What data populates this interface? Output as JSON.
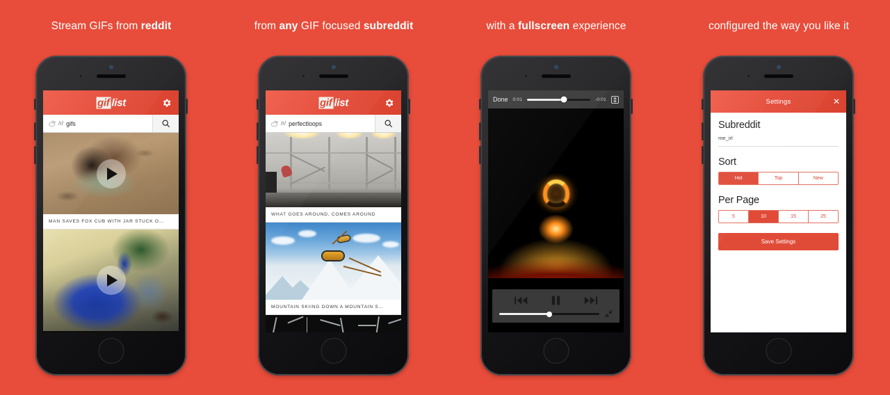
{
  "background_color": "#e84c3a",
  "accent_color": "#e04b38",
  "captions": [
    {
      "plain_before": "Stream GIFs from ",
      "bold": "reddit",
      "plain_after": ""
    },
    {
      "plain_before": "from ",
      "bold": "any",
      "plain_after": " GIF focused ",
      "bold2": "subreddit"
    },
    {
      "plain_before": "with a ",
      "bold": "fullscreen",
      "plain_after": " experience"
    },
    {
      "plain_before": "configured the way you like it",
      "bold": "",
      "plain_after": ""
    }
  ],
  "app": {
    "logo_gif": "gif",
    "logo_list": "list",
    "gear_icon": "gear-icon",
    "reddit_icon": "reddit-alien-icon",
    "search_icon": "search-icon"
  },
  "phone1": {
    "search": {
      "prefix": "/r/",
      "value": "gifs",
      "placeholder": "subreddit"
    },
    "gifs": [
      {
        "caption": "MAN SAVES FOX CUB WITH JAR STUCK O…",
        "art": "fox-cub-in-dirt"
      },
      {
        "caption": "",
        "art": "blue-macaw-parrot"
      }
    ]
  },
  "phone2": {
    "search": {
      "prefix": "/r/",
      "value": "perfectloops",
      "placeholder": "subreddit"
    },
    "gifs": [
      {
        "caption": "WHAT GOES AROUND, COMES AROUND",
        "art": "gym-rig-warehouse"
      },
      {
        "caption": "MOUNTAIN SKIING DOWN A MOUNTAIN S…",
        "art": "snowy-mountain-goggles"
      }
    ]
  },
  "phone3": {
    "player": {
      "done_label": "Done",
      "elapsed": "0:01",
      "remaining": "-0:01",
      "aspect_icon": "aspect-fit-icon",
      "scrub_percent": 58,
      "volume_percent": 50,
      "prev_icon": "previous-track-icon",
      "pause_icon": "pause-icon",
      "next_icon": "next-track-icon",
      "shrink_icon": "shrink-icon",
      "video": "solar-flare-prominence"
    }
  },
  "phone4": {
    "settings": {
      "title": "Settings",
      "close_icon": "close-icon",
      "subreddit_heading": "Subreddit",
      "subreddit_value": "me_irl",
      "sort_heading": "Sort",
      "sort_options": [
        "Hot",
        "Top",
        "New"
      ],
      "sort_selected": "Hot",
      "per_page_heading": "Per Page",
      "per_page_options": [
        "5",
        "10",
        "15",
        "25"
      ],
      "per_page_selected": "10",
      "save_label": "Save Settings"
    }
  }
}
